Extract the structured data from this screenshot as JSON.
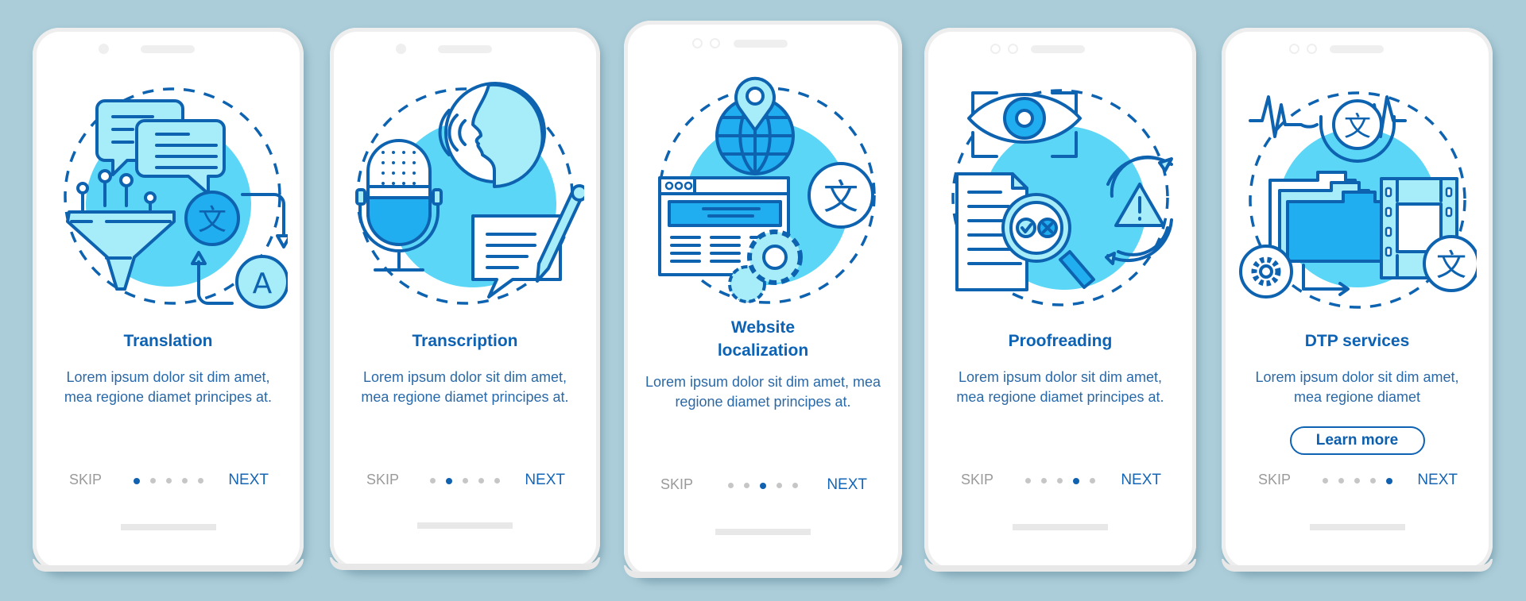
{
  "theme": {
    "background": "#abcdd9",
    "accent": "#0d62b3",
    "circle_fill": "#5cd6f6",
    "light_fill": "#a6edf9",
    "mid_fill": "#20aef0",
    "skip_color": "#9a9a9a",
    "inactive_dot": "#c6c6c6"
  },
  "screens": [
    {
      "title": "Translation",
      "body": "Lorem ipsum dolor sit dim amet, mea regione diamet principes at.",
      "icon": "translation-illustration",
      "skip": "SKIP",
      "next": "NEXT",
      "active_step": 1,
      "total_steps": 5
    },
    {
      "title": "Transcription",
      "body": "Lorem ipsum dolor sit dim amet, mea regione diamet principes at.",
      "icon": "transcription-illustration",
      "skip": "SKIP",
      "next": "NEXT",
      "active_step": 2,
      "total_steps": 5
    },
    {
      "title_line1": "Website",
      "title_line2": "localization",
      "body": "Lorem ipsum dolor sit dim amet, mea regione diamet principes at.",
      "icon": "website-localization-illustration",
      "skip": "SKIP",
      "next": "NEXT",
      "active_step": 3,
      "total_steps": 5
    },
    {
      "title": "Proofreading",
      "body": "Lorem ipsum dolor sit dim amet, mea regione diamet principes at.",
      "icon": "proofreading-illustration",
      "skip": "SKIP",
      "next": "NEXT",
      "active_step": 4,
      "total_steps": 5
    },
    {
      "title": "DTP services",
      "body": "Lorem ipsum dolor sit dim amet, mea regione diamet",
      "icon": "dtp-services-illustration",
      "button": "Learn more",
      "skip": "SKIP",
      "next": "NEXT",
      "active_step": 5,
      "total_steps": 5
    }
  ],
  "glyphs": {
    "chinese_char": "文",
    "latin_char": "A",
    "warning": "!"
  }
}
